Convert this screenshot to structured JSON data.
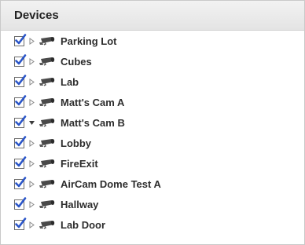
{
  "panel": {
    "title": "Devices"
  },
  "devices": [
    {
      "label": "Parking Lot",
      "checked": true,
      "expanded": false
    },
    {
      "label": "Cubes",
      "checked": true,
      "expanded": false
    },
    {
      "label": "Lab",
      "checked": true,
      "expanded": false
    },
    {
      "label": "Matt's Cam A",
      "checked": true,
      "expanded": false
    },
    {
      "label": "Matt's Cam B",
      "checked": true,
      "expanded": true
    },
    {
      "label": "Lobby",
      "checked": true,
      "expanded": false
    },
    {
      "label": "FireExit",
      "checked": true,
      "expanded": false
    },
    {
      "label": "AirCam Dome Test A",
      "checked": true,
      "expanded": false
    },
    {
      "label": "Hallway",
      "checked": true,
      "expanded": false
    },
    {
      "label": "Lab Door",
      "checked": true,
      "expanded": false
    }
  ],
  "icons": {
    "checkbox": "checkmark-icon",
    "expander_collapsed": "triangle-right-icon",
    "expander_expanded": "triangle-down-icon",
    "device": "camera-icon"
  },
  "colors": {
    "check": "#2a55c8",
    "header_bg": "#e8e8e8",
    "text": "#2d2d2d"
  }
}
